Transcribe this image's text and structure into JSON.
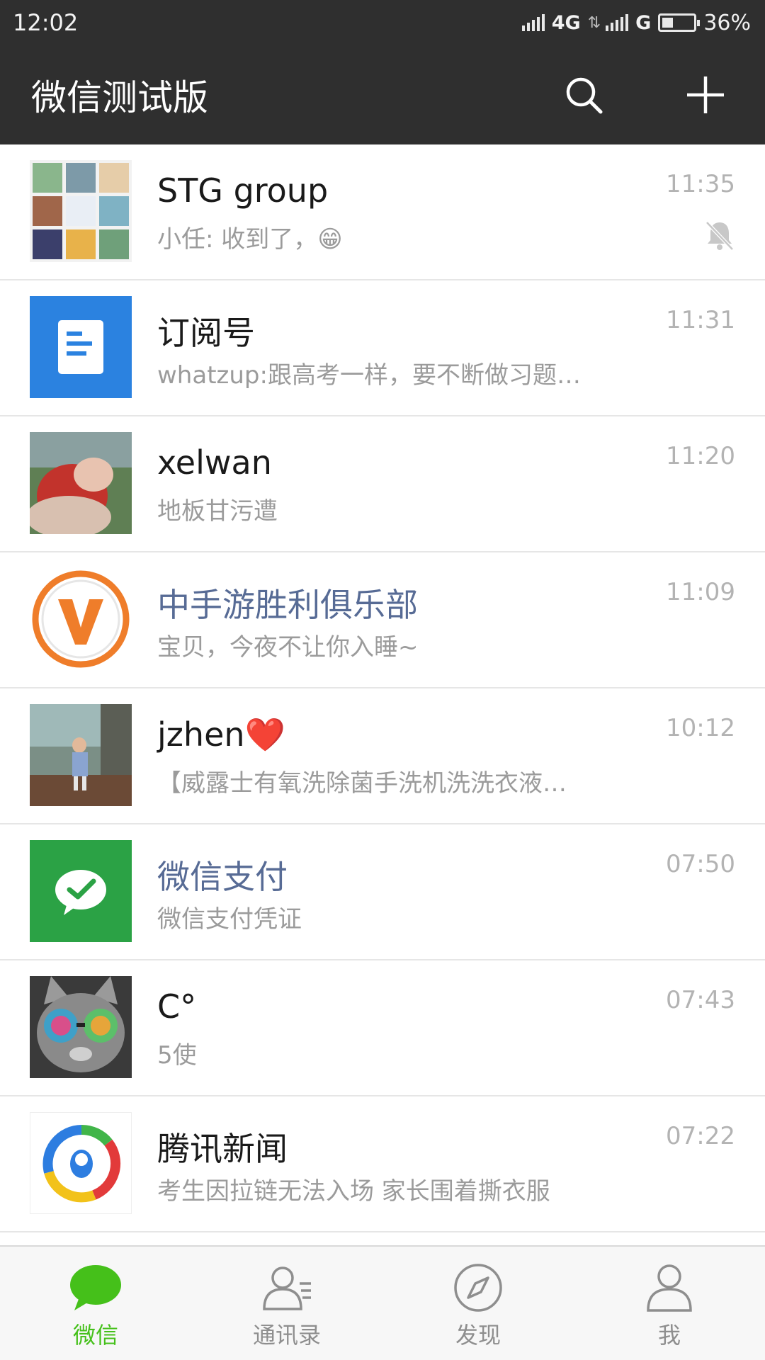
{
  "status_bar": {
    "time": "12:02",
    "network_1": "4G",
    "network_2": "G",
    "battery_percent": "36%",
    "battery_level": 0.36
  },
  "header": {
    "title": "微信测试版",
    "search_icon": "search-icon",
    "add_icon": "plus-icon"
  },
  "chats": [
    {
      "name": "STG group",
      "preview": "小任: 收到了，😁",
      "time": "11:35",
      "muted": true
    },
    {
      "name": "订阅号",
      "preview": "whatzup:跟高考一样，要不断做习题…",
      "time": "11:31"
    },
    {
      "name": "xelwan",
      "preview": "地板甘污遭",
      "time": "11:20"
    },
    {
      "name": "中手游胜利俱乐部",
      "preview": "宝贝，今夜不让你入睡~",
      "time": "11:09"
    },
    {
      "name": "jzhen❤️",
      "preview": "【威露士有氧洗除菌手洗机洗洗衣液…",
      "time": "10:12"
    },
    {
      "name": "微信支付",
      "preview": "微信支付凭证",
      "time": "07:50"
    },
    {
      "name": "C°",
      "preview": "5使",
      "time": "07:43"
    },
    {
      "name": "腾讯新闻",
      "preview": "考生因拉链无法入场 家长围着撕衣服",
      "time": "07:22"
    }
  ],
  "tabs": [
    {
      "label": "微信",
      "icon": "chat-bubble-icon",
      "active": true
    },
    {
      "label": "通讯录",
      "icon": "contacts-icon"
    },
    {
      "label": "发现",
      "icon": "compass-icon"
    },
    {
      "label": "我",
      "icon": "person-icon"
    }
  ],
  "colors": {
    "header_bg": "#2f2f2f",
    "accent_green": "#45c01a",
    "link_name": "#576b95",
    "subscription_blue": "#2b82e0",
    "pay_green": "#2ba245"
  }
}
